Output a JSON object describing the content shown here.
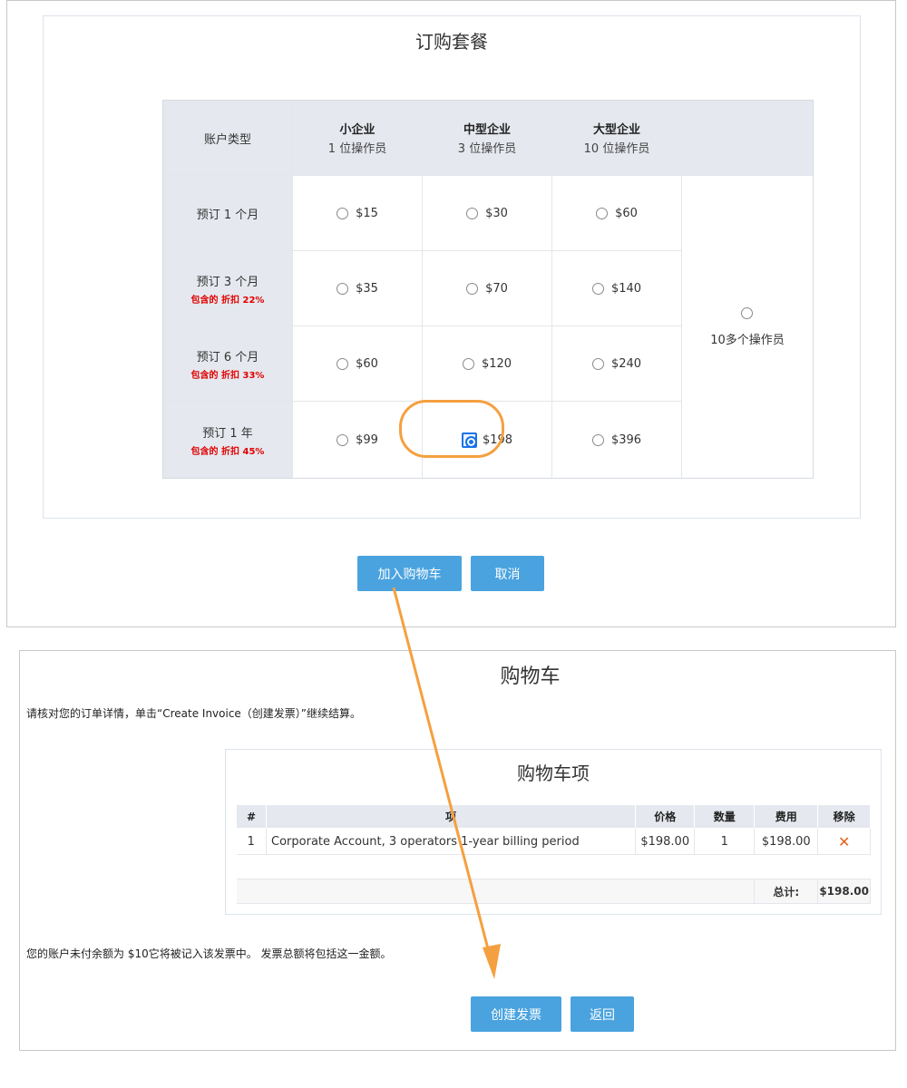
{
  "order": {
    "title": "订购套餐",
    "header": {
      "account_type_label": "账户类型",
      "plans": [
        {
          "name": "小企业",
          "operators": "1 位操作员"
        },
        {
          "name": "中型企业",
          "operators": "3 位操作员"
        },
        {
          "name": "大型企业",
          "operators": "10 位操作员"
        }
      ]
    },
    "rows": [
      {
        "label": "预订 1 个月",
        "discount": "",
        "prices": [
          "$15",
          "$30",
          "$60"
        ]
      },
      {
        "label": "预订 3 个月",
        "discount": "包含的 折扣 22%",
        "prices": [
          "$35",
          "$70",
          "$140"
        ]
      },
      {
        "label": "预订 6 个月",
        "discount": "包含的 折扣 33%",
        "prices": [
          "$60",
          "$120",
          "$240"
        ]
      },
      {
        "label": "预订 1 年",
        "discount": "包含的 折扣 45%",
        "prices": [
          "$99",
          "$198",
          "$396"
        ]
      }
    ],
    "selected": {
      "row": 3,
      "col": 1
    },
    "more_operators_label": "10多个操作员",
    "add_to_cart_label": "加入购物车",
    "cancel_label": "取消"
  },
  "cart": {
    "title": "购物车",
    "instructions": "请核对您的订单详情，单击“Create Invoice（创建发票）”继续结算。",
    "items_title": "购物车项",
    "columns": [
      "#",
      "项",
      "价格",
      "数量",
      "费用",
      "移除"
    ],
    "items": [
      {
        "num": "1",
        "item": "Corporate Account, 3 operators 1-year billing period",
        "price": "$198.00",
        "qty": "1",
        "cost": "$198.00",
        "remove_icon": "close-icon"
      }
    ],
    "total_label": "总计:",
    "total_value": "$198.00",
    "balance_note": "您的账户未付余额为 $10它将被记入该发票中。 发票总额将包括这一金额。",
    "create_invoice_label": "创建发票",
    "back_label": "返回"
  },
  "colors": {
    "button": "#4aa3df",
    "annotation": "#f5a040",
    "discount": "#e00000",
    "remove": "#e8631a",
    "radio_selected": "#1a73e8"
  }
}
